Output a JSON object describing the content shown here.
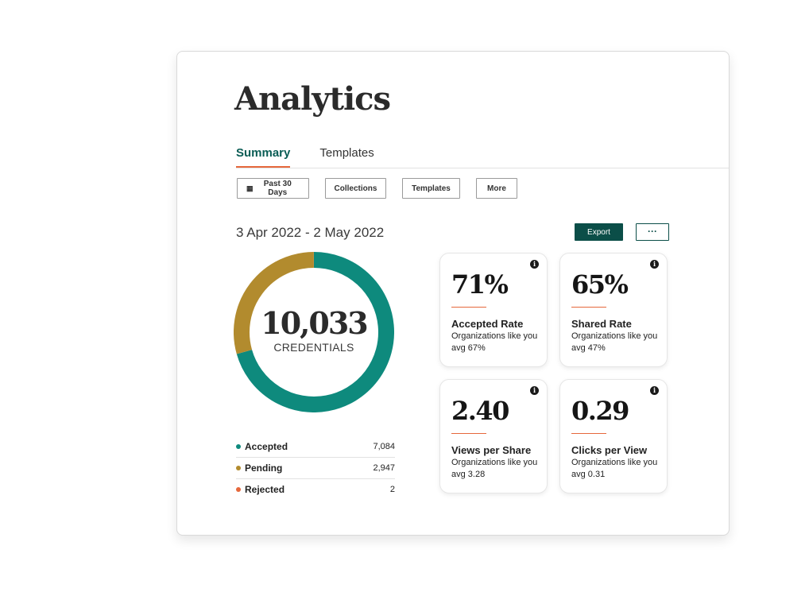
{
  "page": {
    "title": "Analytics"
  },
  "tabs": [
    {
      "label": "Summary",
      "active": true
    },
    {
      "label": "Templates",
      "active": false
    }
  ],
  "filters": {
    "date_icon": "calendar-icon",
    "date": "Past 30 Days",
    "collections": "Collections",
    "templates": "Templates",
    "more": "More"
  },
  "summary": {
    "date_range": "3 Apr 2022 - 2 May 2022",
    "export_label": "Export",
    "overflow_label": "···"
  },
  "donut": {
    "total": "10,033",
    "caption": "CREDENTIALS",
    "segments": [
      {
        "name": "Accepted",
        "value": 7084,
        "display": "7,084",
        "color": "#0e8a7d"
      },
      {
        "name": "Pending",
        "value": 2947,
        "display": "2,947",
        "color": "#b28b2e"
      },
      {
        "name": "Rejected",
        "value": 2,
        "display": "2",
        "color": "#e6683c"
      }
    ]
  },
  "metrics": [
    {
      "value": "71%",
      "label": "Accepted Rate",
      "note": "Organizations like you avg 67%",
      "icon": "info-icon"
    },
    {
      "value": "65%",
      "label": "Shared Rate",
      "note": "Organizations like you avg 47%",
      "icon": "info-icon"
    },
    {
      "value": "2.40",
      "label": "Views per Share",
      "note": "Organizations like you avg 3.28",
      "icon": "info-icon"
    },
    {
      "value": "0.29",
      "label": "Clicks per View",
      "note": "Organizations like you avg 0.31",
      "icon": "info-icon"
    }
  ],
  "colors": {
    "brand": "#0b4e48",
    "accent": "#e6683c",
    "teal": "#0e8a7d",
    "gold": "#b28b2e"
  }
}
